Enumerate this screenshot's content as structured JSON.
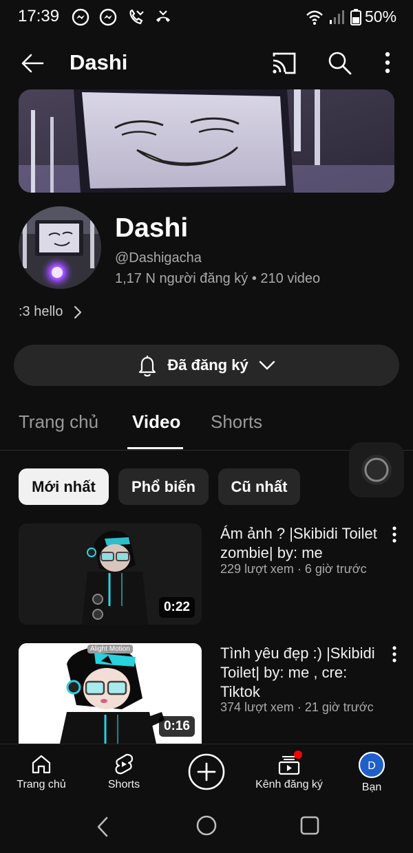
{
  "status_bar": {
    "time": "17:39",
    "battery": "50%",
    "icons": [
      "messenger-icon",
      "messenger-icon",
      "missed-call-icon",
      "call-end-icon",
      "wifi-icon",
      "signal-icon",
      "battery-icon"
    ]
  },
  "top_bar": {
    "title": "Dashi",
    "icons": [
      "back-arrow-icon",
      "cast-icon",
      "search-icon",
      "more-vert-icon"
    ]
  },
  "channel": {
    "name": "Dashi",
    "handle": "@Dashigacha",
    "stats": "1,17 N người đăng ký • 210 video",
    "description": ":3 hello"
  },
  "subscribe": {
    "label": "Đã đăng ký",
    "icon": "bell-icon"
  },
  "tabs": [
    {
      "label": "Trang chủ",
      "active": false
    },
    {
      "label": "Video",
      "active": true
    },
    {
      "label": "Shorts",
      "active": false
    }
  ],
  "filters": [
    {
      "label": "Mới nhất",
      "active": true
    },
    {
      "label": "Phổ biến",
      "active": false
    },
    {
      "label": "Cũ nhất",
      "active": false
    }
  ],
  "videos": [
    {
      "title": "Ám ảnh ? |Skibidi Toilet zombie| by: me",
      "meta": "229 lượt xem · 6 giờ trước",
      "duration": "0:22"
    },
    {
      "title": "Tình yêu đẹp :) |Skibidi Toilet| by: me , cre: Tiktok",
      "meta": "374 lượt xem · 21 giờ trước",
      "duration": "0:16",
      "watermark": "Alight Motion"
    }
  ],
  "bottom_nav": [
    {
      "label": "Trang chủ",
      "icon": "home-icon"
    },
    {
      "label": "Shorts",
      "icon": "shorts-icon"
    },
    {
      "label": "",
      "icon": "create-plus-icon"
    },
    {
      "label": "Kênh đăng ký",
      "icon": "subscriptions-icon"
    },
    {
      "label": "Bạn",
      "icon": "account-avatar",
      "avatar_letter": "D"
    }
  ],
  "colors": {
    "background": "#0f0f0f",
    "chip": "#272727",
    "accent_red": "#ff0000",
    "avatar_blue": "#1e5fc9"
  }
}
